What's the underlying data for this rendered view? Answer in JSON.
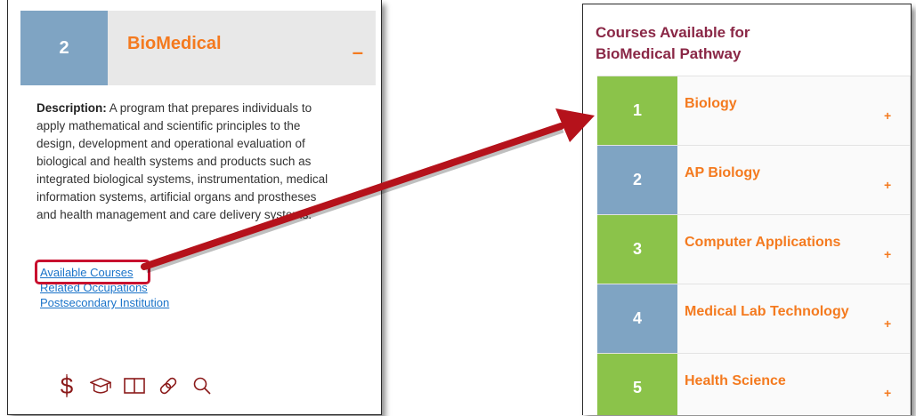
{
  "pathway": {
    "number": "2",
    "title": "BioMedical",
    "toggle": "–",
    "description_label": "Description:",
    "description_text": " A program that prepares individuals to apply mathematical and scientific principles to the design, development and operational evaluation of biological and health systems and products such as integrated biological systems, instrumentation, medical information systems, artificial organs and prostheses and health management and care delivery systems.",
    "links": [
      "Available Courses",
      "Related Occupations",
      "Postsecondary Institution"
    ],
    "icons": [
      "dollar-icon",
      "graduation-cap-icon",
      "book-icon",
      "link-icon",
      "search-icon"
    ]
  },
  "courses_panel": {
    "title_line1": "Courses Available for",
    "title_line2": "BioMedical Pathway",
    "courses": [
      {
        "number": "1",
        "name": "Biology",
        "toggle": "+",
        "color": "#8bc34a"
      },
      {
        "number": "2",
        "name": "AP Biology",
        "toggle": "+",
        "color": "#7fa4c3"
      },
      {
        "number": "3",
        "name": "Computer Applications",
        "toggle": "+",
        "color": "#8bc34a"
      },
      {
        "number": "4",
        "name": "Medical Lab Technology",
        "toggle": "+",
        "color": "#7fa4c3"
      },
      {
        "number": "5",
        "name": "Health Science",
        "toggle": "+",
        "color": "#8bc34a"
      }
    ]
  },
  "colors": {
    "accent_orange": "#f47a1f",
    "title_maroon": "#8a2746",
    "green": "#8bc34a",
    "blue": "#7fa4c3",
    "arrow_red": "#b5121b",
    "link_blue": "#1a73c9"
  }
}
